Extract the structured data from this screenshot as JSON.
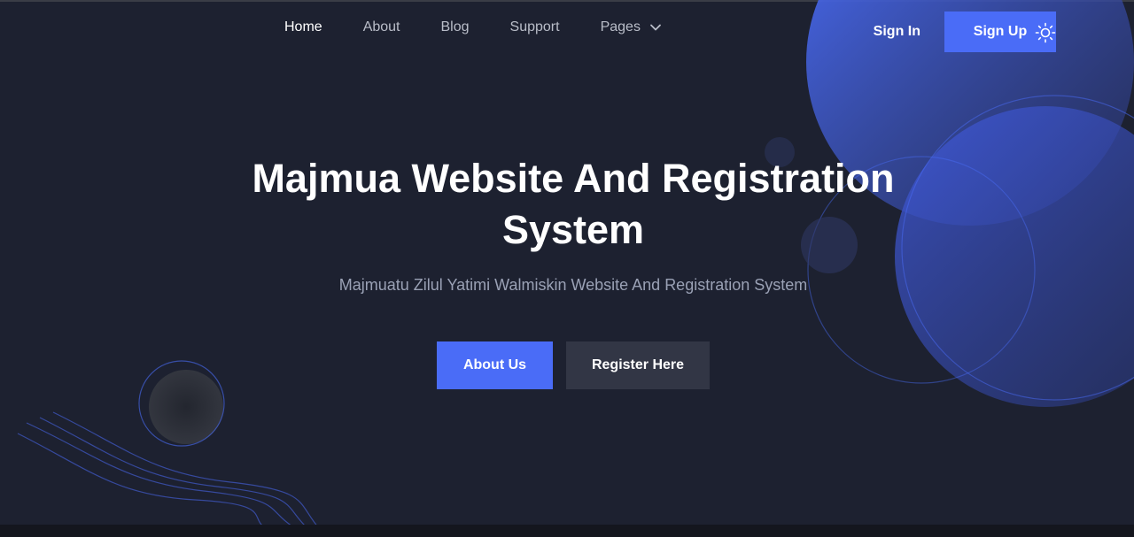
{
  "nav": {
    "items": [
      {
        "label": "Home",
        "active": true
      },
      {
        "label": "About",
        "active": false
      },
      {
        "label": "Blog",
        "active": false
      },
      {
        "label": "Support",
        "active": false
      },
      {
        "label": "Pages",
        "active": false,
        "icon": "chevron-down-icon"
      }
    ],
    "signin_label": "Sign In",
    "signup_label": "Sign Up",
    "theme_icon": "sun-icon"
  },
  "hero": {
    "title": "Majmua Website And Registration System",
    "subtitle": "Majmuatu Zilul Yatimi Walmiskin Website And Registration System",
    "primary_button": "About Us",
    "secondary_button": "Register Here"
  },
  "colors": {
    "background": "#1d2130",
    "accent": "#4a6cf7",
    "secondary_button": "#323645",
    "muted_text": "#9aa1b5"
  }
}
